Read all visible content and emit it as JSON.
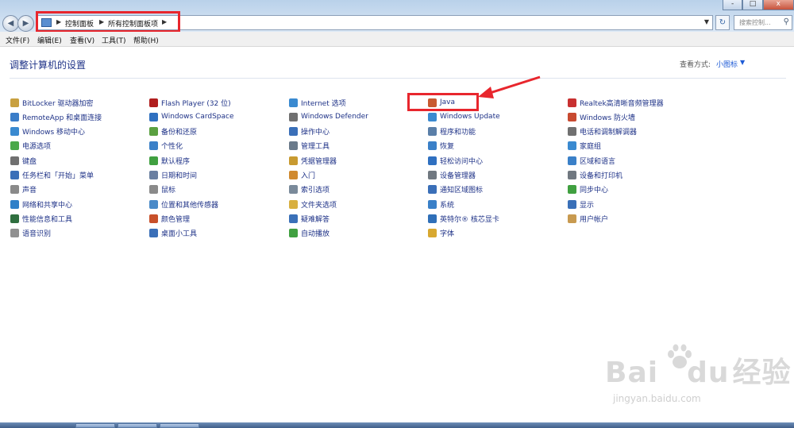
{
  "window": {
    "breadcrumbs": [
      "控制面板",
      "所有控制面板项"
    ],
    "search_placeholder": "搜索控制...",
    "title_buttons": {
      "minimize": "-",
      "maximize": "□",
      "close": "x"
    }
  },
  "menu": [
    "文件(F)",
    "编辑(E)",
    "查看(V)",
    "工具(T)",
    "帮助(H)"
  ],
  "content": {
    "heading": "调整计算机的设置",
    "view_by_label": "查看方式:",
    "view_by_value": "小图标"
  },
  "columns": [
    [
      {
        "label": "BitLocker 驱动器加密",
        "color": "#c8a040"
      },
      {
        "label": "RemoteApp 和桌面连接",
        "color": "#3a7dc8"
      },
      {
        "label": "Windows 移动中心",
        "color": "#3a8ad0"
      },
      {
        "label": "电源选项",
        "color": "#4aa84a"
      },
      {
        "label": "键盘",
        "color": "#707070"
      },
      {
        "label": "任务栏和「开始」菜单",
        "color": "#3a6fb8"
      },
      {
        "label": "声音",
        "color": "#8a8a8a"
      },
      {
        "label": "网络和共享中心",
        "color": "#2f80c8"
      },
      {
        "label": "性能信息和工具",
        "color": "#2f6f3f"
      },
      {
        "label": "语音识别",
        "color": "#909090"
      }
    ],
    [
      {
        "label": "Flash Player (32 位)",
        "color": "#b01e1e"
      },
      {
        "label": "Windows CardSpace",
        "color": "#2f70c0"
      },
      {
        "label": "备份和还原",
        "color": "#5aa040"
      },
      {
        "label": "个性化",
        "color": "#3a80c8"
      },
      {
        "label": "默认程序",
        "color": "#40a040"
      },
      {
        "label": "日期和时间",
        "color": "#6a7fa0"
      },
      {
        "label": "鼠标",
        "color": "#8a8a8a"
      },
      {
        "label": "位置和其他传感器",
        "color": "#4a8ac8"
      },
      {
        "label": "颜色管理",
        "color": "#c8502a"
      },
      {
        "label": "桌面小工具",
        "color": "#3a6fb8"
      }
    ],
    [
      {
        "label": "Internet 选项",
        "color": "#3a8ad0"
      },
      {
        "label": "Windows Defender",
        "color": "#707070"
      },
      {
        "label": "操作中心",
        "color": "#3a6fb8"
      },
      {
        "label": "管理工具",
        "color": "#6a7a8a"
      },
      {
        "label": "凭据管理器",
        "color": "#c89a30"
      },
      {
        "label": "入门",
        "color": "#d08a30"
      },
      {
        "label": "索引选项",
        "color": "#7a8a9a"
      },
      {
        "label": "文件夹选项",
        "color": "#d8b040"
      },
      {
        "label": "疑难解答",
        "color": "#3a70b8"
      },
      {
        "label": "自动播放",
        "color": "#40a040"
      }
    ],
    [
      {
        "label": "Java",
        "color": "#c85a30"
      },
      {
        "label": "Windows Update",
        "color": "#3a8ad0"
      },
      {
        "label": "程序和功能",
        "color": "#5a7fa8"
      },
      {
        "label": "恢复",
        "color": "#3a80c8"
      },
      {
        "label": "轻松访问中心",
        "color": "#2f70c0"
      },
      {
        "label": "设备管理器",
        "color": "#707880"
      },
      {
        "label": "通知区域图标",
        "color": "#3a6fb8"
      },
      {
        "label": "系统",
        "color": "#3a80c8"
      },
      {
        "label": "英特尔® 核芯显卡",
        "color": "#2f6fb8"
      },
      {
        "label": "字体",
        "color": "#d8a830"
      }
    ],
    [
      {
        "label": "Realtek高清晰音频管理器",
        "color": "#c83030"
      },
      {
        "label": "Windows 防火墙",
        "color": "#c84a30"
      },
      {
        "label": "电话和调制解调器",
        "color": "#707070"
      },
      {
        "label": "家庭组",
        "color": "#3a8ad0"
      },
      {
        "label": "区域和语言",
        "color": "#3a80c8"
      },
      {
        "label": "设备和打印机",
        "color": "#707880"
      },
      {
        "label": "同步中心",
        "color": "#40a040"
      },
      {
        "label": "显示",
        "color": "#3a70b8"
      },
      {
        "label": "用户帐户",
        "color": "#c89a50"
      }
    ]
  ],
  "watermark": {
    "brand_a": "Bai",
    "brand_b": "du",
    "brand_c": "经验",
    "url": "jingyan.baidu.com"
  }
}
